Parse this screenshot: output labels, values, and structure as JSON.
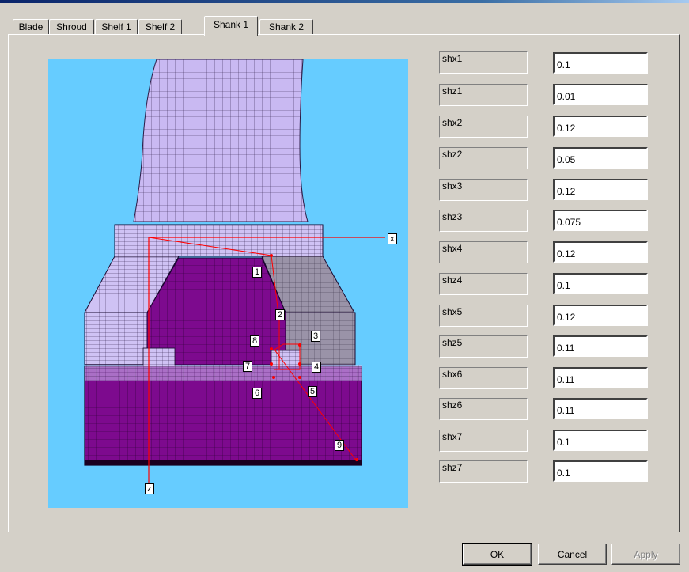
{
  "tabs": [
    "Blade",
    "Shroud",
    "Shelf 1",
    "Shelf 2",
    "Shank 1",
    "Shank 2"
  ],
  "active_tab": "Shank 1",
  "parameters": [
    {
      "label": "shx1",
      "value": "0.1"
    },
    {
      "label": "shz1",
      "value": "0.01"
    },
    {
      "label": "shx2",
      "value": "0.12"
    },
    {
      "label": "shz2",
      "value": "0.05"
    },
    {
      "label": "shx3",
      "value": "0.12"
    },
    {
      "label": "shz3",
      "value": "0.075"
    },
    {
      "label": "shx4",
      "value": "0.12"
    },
    {
      "label": "shz4",
      "value": "0.1"
    },
    {
      "label": "shx5",
      "value": "0.12"
    },
    {
      "label": "shz5",
      "value": "0.11"
    },
    {
      "label": "shx6",
      "value": "0.11"
    },
    {
      "label": "shz6",
      "value": "0.11"
    },
    {
      "label": "shx7",
      "value": "0.1"
    },
    {
      "label": "shz7",
      "value": "0.1"
    }
  ],
  "diagram": {
    "axis_x": "x",
    "axis_z": "z",
    "points": [
      "1",
      "2",
      "3",
      "4",
      "5",
      "6",
      "7",
      "8",
      "9"
    ]
  },
  "buttons": {
    "ok": "OK",
    "cancel": "Cancel",
    "apply": "Apply"
  },
  "colors": {
    "viewport_bg": "#66ccff",
    "blade": "#c8b8f0",
    "shank": "#7a0a8a",
    "annotation": "#ff0000"
  }
}
